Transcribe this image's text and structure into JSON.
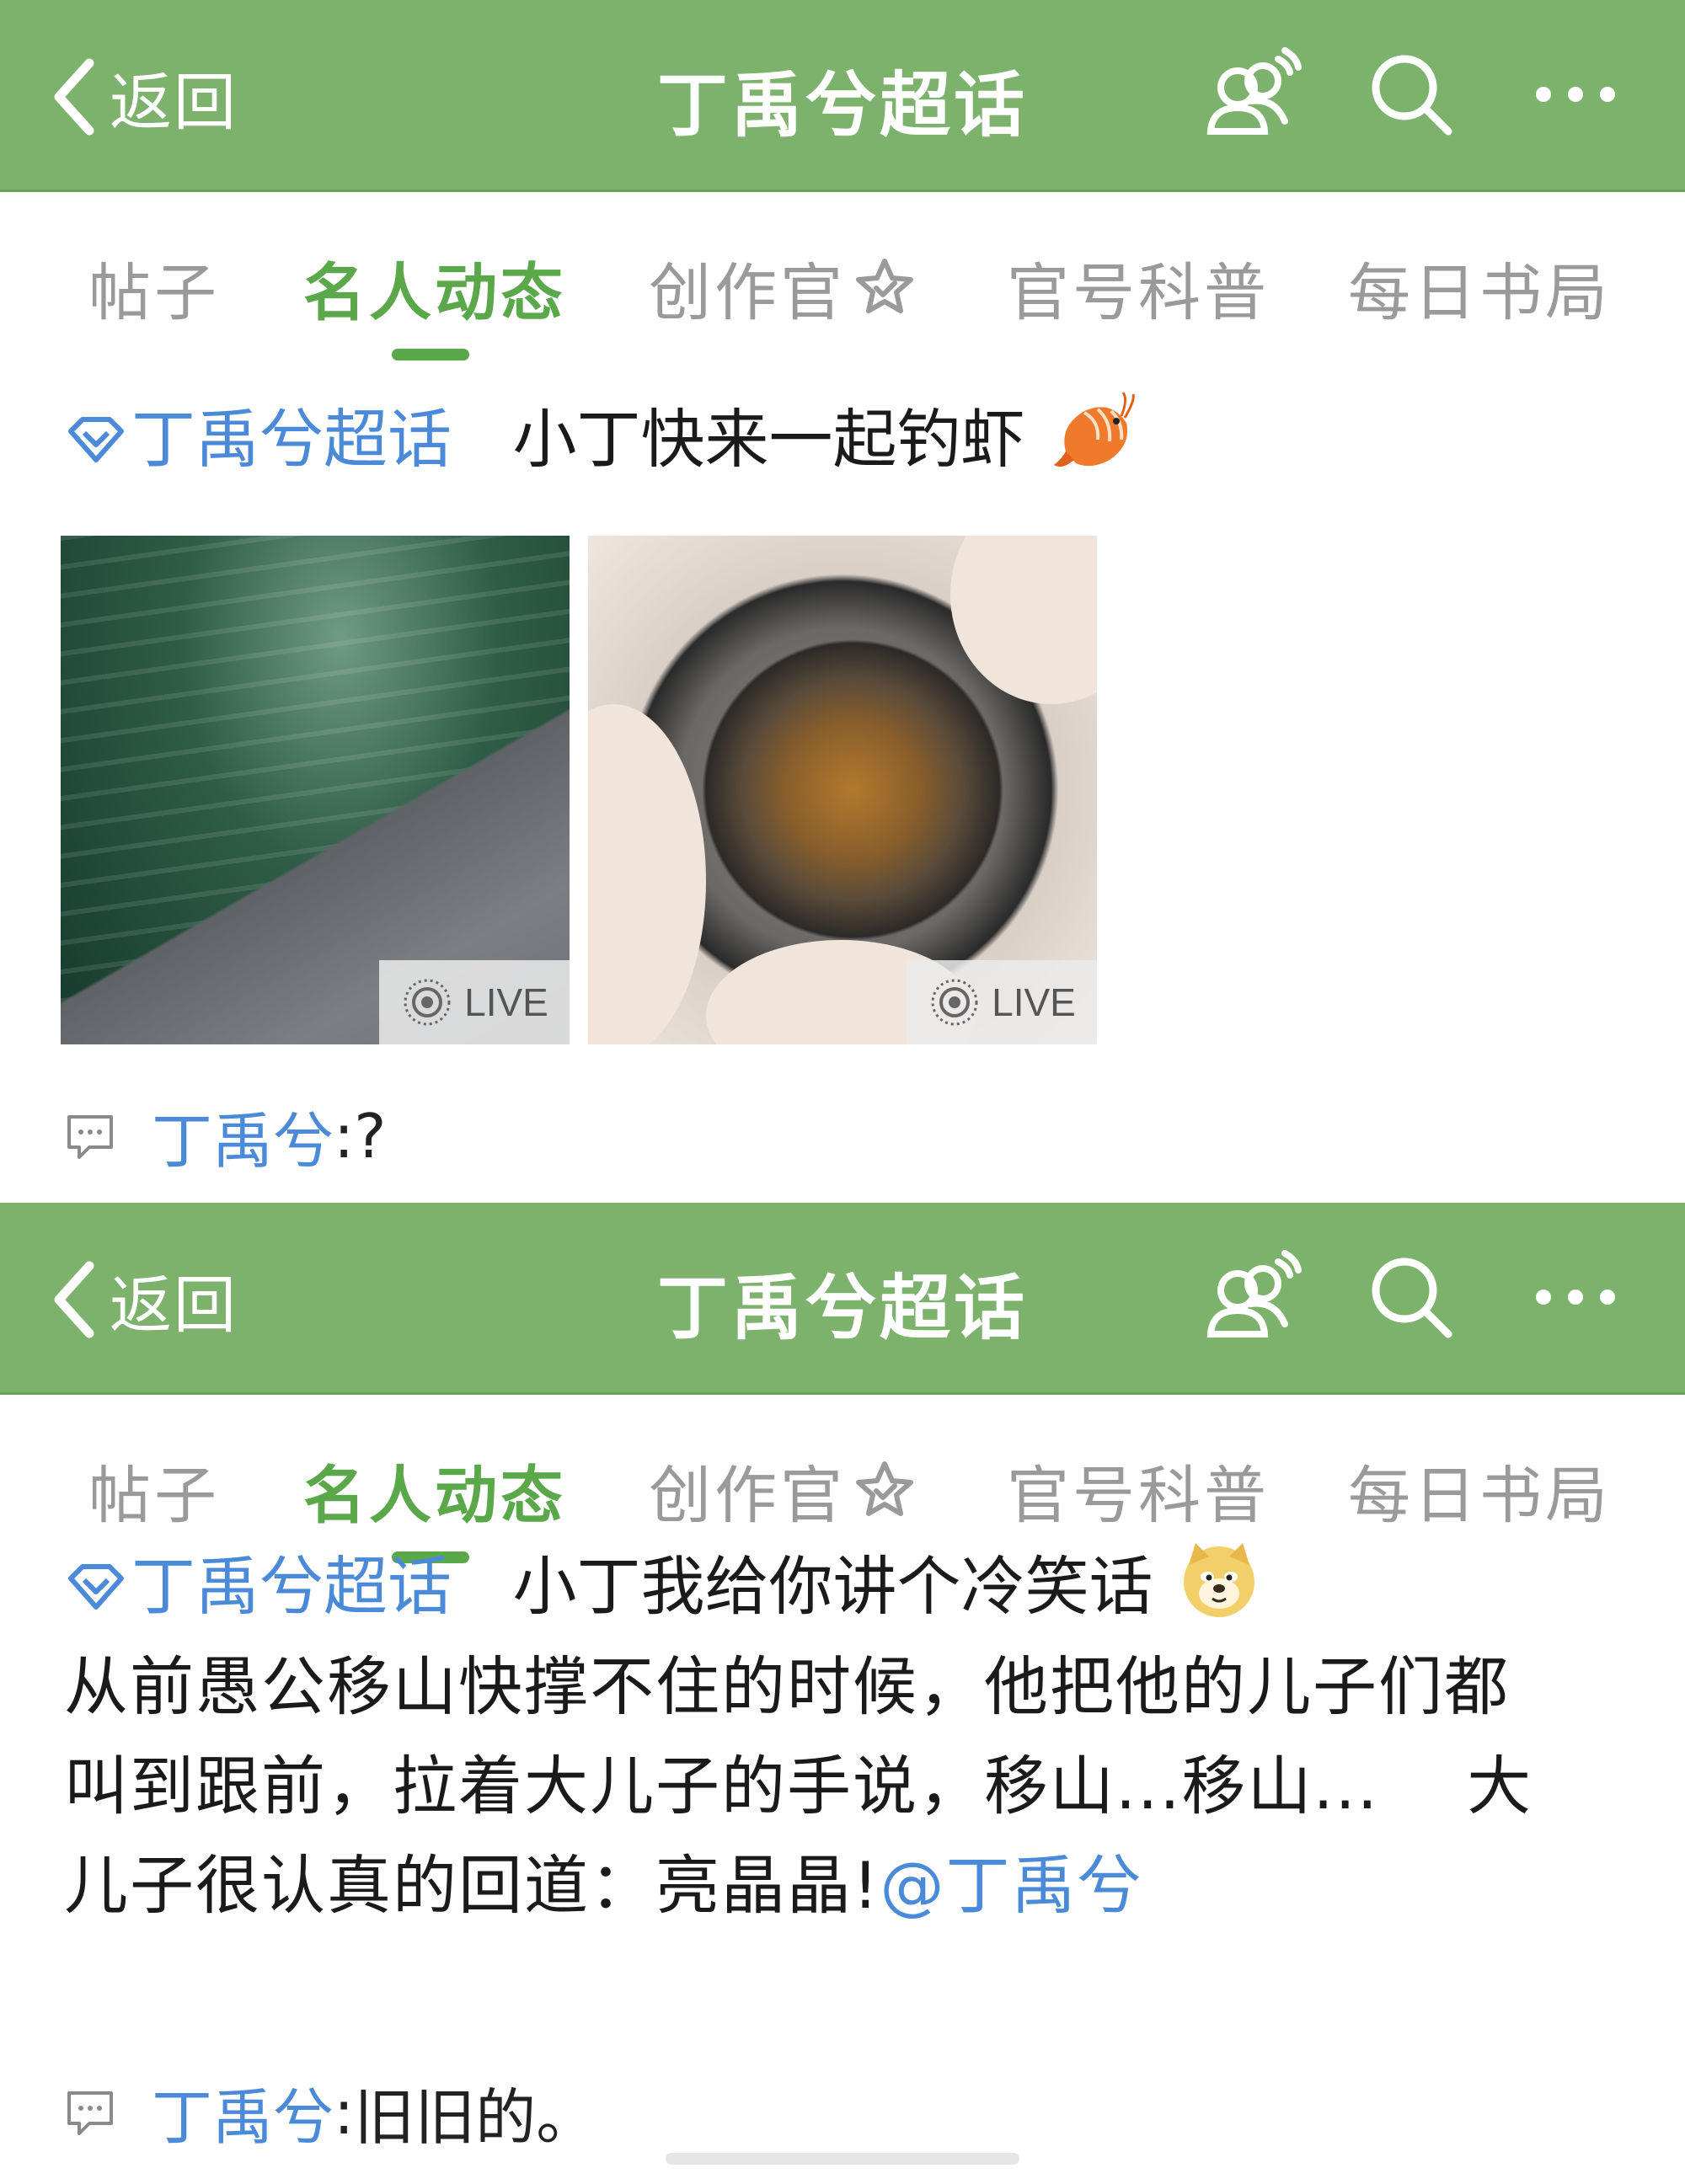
{
  "screens": [
    {
      "nav": {
        "back_label": "返回",
        "title": "丁禹兮超话",
        "icons": [
          "chat-bubbles-icon",
          "search-icon",
          "more-icon"
        ]
      },
      "tabs": [
        {
          "label": "帖子",
          "active": false
        },
        {
          "label": "名人动态",
          "active": true
        },
        {
          "label": "创作官",
          "active": false,
          "icon": "star-badge-icon"
        },
        {
          "label": "官号科普",
          "active": false
        },
        {
          "label": "每日书局",
          "active": false
        }
      ],
      "post": {
        "topic": "丁禹兮超话",
        "text": "小丁快来一起钓虾",
        "emoji": "shrimp-emoji",
        "images": [
          {
            "badge": "LIVE",
            "subject": "water-pool-photo"
          },
          {
            "badge": "LIVE",
            "subject": "shrimp-in-net-photo"
          }
        ],
        "reply": {
          "user": "丁禹兮",
          "separator": ":",
          "text": " ?"
        }
      }
    },
    {
      "nav": {
        "back_label": "返回",
        "title": "丁禹兮超话",
        "icons": [
          "chat-bubbles-icon",
          "search-icon",
          "more-icon"
        ]
      },
      "tabs": [
        {
          "label": "帖子",
          "active": false
        },
        {
          "label": "名人动态",
          "active": true
        },
        {
          "label": "创作官",
          "active": false,
          "icon": "star-badge-icon"
        },
        {
          "label": "官号科普",
          "active": false
        },
        {
          "label": "每日书局",
          "active": false
        }
      ],
      "post": {
        "topic": "丁禹兮超话",
        "text": "小丁我给你讲个冷笑话",
        "emoji": "doge-emoji",
        "body_lines": [
          "从前愚公移山快撑不住的时候，他把他的儿子们都",
          "叫到跟前，拉着大儿子的手说，移山...移山...　 大",
          "儿子很认真的回道：亮晶晶!"
        ],
        "mention": "@丁禹兮",
        "reply": {
          "user": "丁禹兮",
          "separator": ":",
          "text": " 旧旧的。"
        }
      }
    }
  ],
  "colors": {
    "nav_green": "#7cb26c",
    "tab_active": "#5aa84a",
    "link_blue": "#4a8ad8",
    "tab_inactive": "#9a9a9a"
  }
}
